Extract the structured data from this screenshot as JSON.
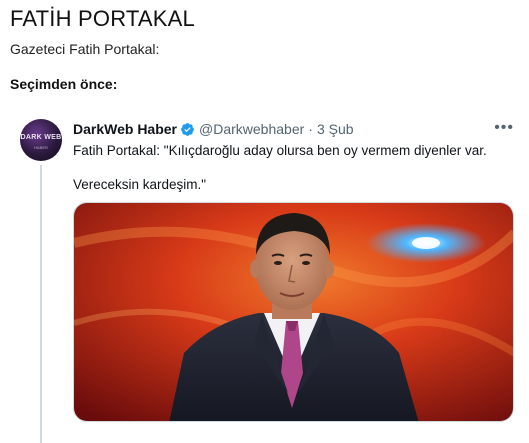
{
  "post": {
    "title": "FATİH PORTAKAL",
    "subtitle": "Gazeteci Fatih Portakal:",
    "section_label": "Seçimden önce:"
  },
  "tweet": {
    "avatar_text": "DARK WEB",
    "avatar_subtext": "HABER",
    "author_name": "DarkWeb Haber",
    "handle": "@Darkwebhaber",
    "separator": "·",
    "date": "3 Şub",
    "more_icon": "more-horizontal-icon",
    "text_line1": "Fatih Portakal: \"Kılıçdaroğlu aday olursa ben oy vermem diyenler var.",
    "text_line2": "Vereceksin kardeşim.\"",
    "verified_color": "#1d9bf0",
    "media": {
      "description": "photo-of-man-in-suit",
      "background_colors": [
        "#8a1412",
        "#e0431c",
        "#f08a2e"
      ]
    }
  }
}
